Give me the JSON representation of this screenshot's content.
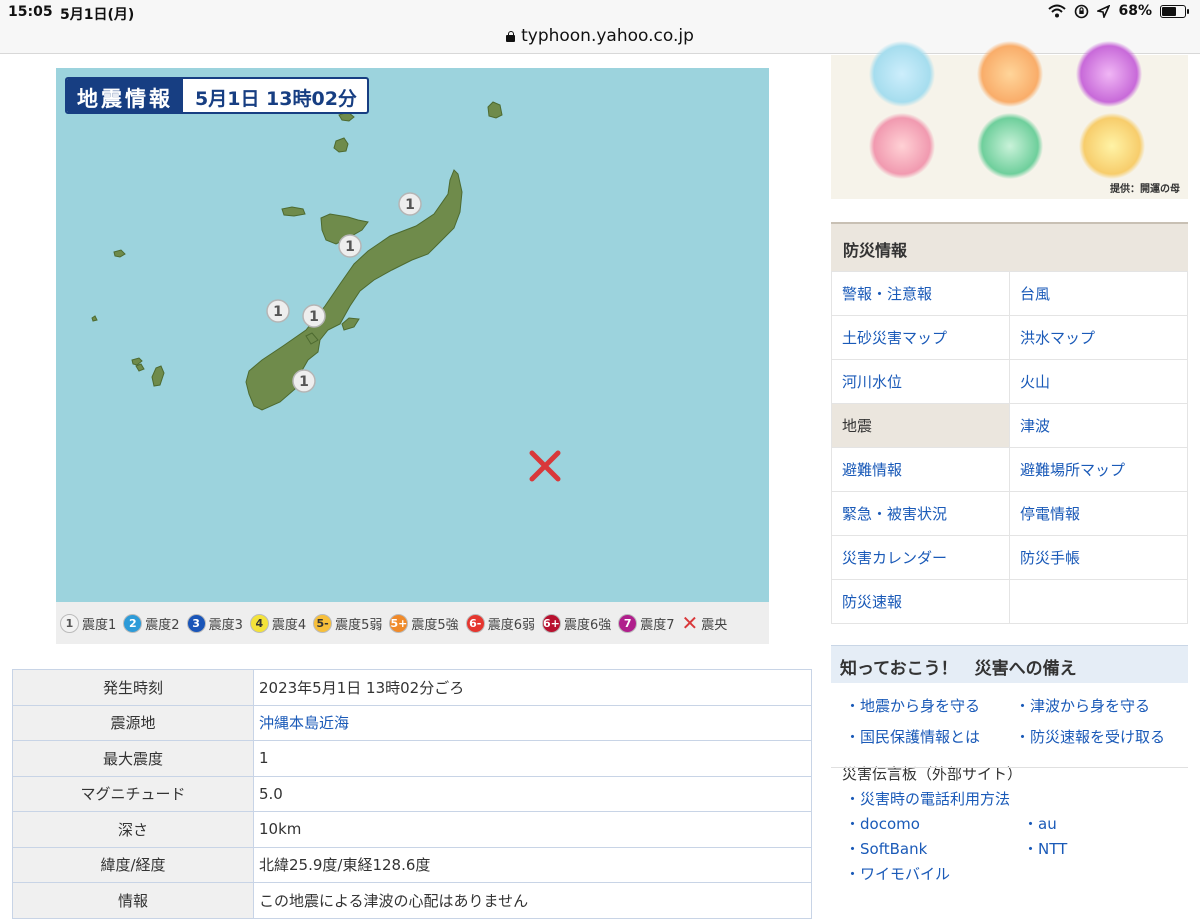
{
  "status_bar": {
    "time": "15:05",
    "date": "5月1日(月)",
    "battery": "68%",
    "battery_level": 0.68
  },
  "browser": {
    "url": "typhoon.yahoo.co.jp"
  },
  "map": {
    "title": "地震情報",
    "datetime": "5月1日 13時02分",
    "intensity_markers": [
      "1",
      "1",
      "1",
      "1",
      "1"
    ],
    "epicenter_icon": "epicenter-x-icon",
    "colors": {
      "sea": "#9cd3dd",
      "land": "#6f8b4b",
      "label": "#173e82",
      "epicenter": "#d9383a"
    }
  },
  "legend": [
    {
      "sym": "1",
      "label": "震度1",
      "bg": "#f2f2f2",
      "fg": "#555"
    },
    {
      "sym": "2",
      "label": "震度2",
      "bg": "#2d9bd8",
      "fg": "#fff"
    },
    {
      "sym": "3",
      "label": "震度3",
      "bg": "#1a55b8",
      "fg": "#fff"
    },
    {
      "sym": "4",
      "label": "震度4",
      "bg": "#f3e23a",
      "fg": "#333"
    },
    {
      "sym": "5-",
      "label": "震度5弱",
      "bg": "#f7bf3a",
      "fg": "#333"
    },
    {
      "sym": "5+",
      "label": "震度5強",
      "bg": "#f08a2a",
      "fg": "#fff"
    },
    {
      "sym": "6-",
      "label": "震度6弱",
      "bg": "#e5362f",
      "fg": "#fff"
    },
    {
      "sym": "6+",
      "label": "震度6強",
      "bg": "#b8112f",
      "fg": "#fff"
    },
    {
      "sym": "7",
      "label": "震度7",
      "bg": "#b01f8c",
      "fg": "#fff"
    }
  ],
  "legend_epicenter": "震央",
  "info_table": [
    {
      "key": "発生時刻",
      "value": "2023年5月1日 13時02分ごろ",
      "link": false
    },
    {
      "key": "震源地",
      "value": "沖縄本島近海",
      "link": true
    },
    {
      "key": "最大震度",
      "value": "1",
      "link": false
    },
    {
      "key": "マグニチュード",
      "value": "5.0",
      "link": false
    },
    {
      "key": "深さ",
      "value": "10km",
      "link": false
    },
    {
      "key": "緯度/経度",
      "value": "北緯25.9度/東経128.6度",
      "link": false
    },
    {
      "key": "情報",
      "value": "この地震による津波の心配はありません",
      "link": false
    }
  ],
  "ad": {
    "credit": "提供：開運の母"
  },
  "bosai": {
    "title": "防災情報",
    "items": [
      "警報・注意報",
      "台風",
      "土砂災害マップ",
      "洪水マップ",
      "河川水位",
      "火山",
      "地震",
      "津波",
      "避難情報",
      "避難場所マップ",
      "緊急・被害状況",
      "停電情報",
      "災害カレンダー",
      "防災手帳",
      "防災速報",
      ""
    ],
    "active": "地震"
  },
  "prep": {
    "title": "知っておこう！　災害への備え",
    "links": [
      "・地震から身を守る",
      "・津波から身を守る",
      "・国民保護情報とは",
      "・防災速報を受け取る"
    ],
    "dengon_title": "災害伝言板（外部サイト）",
    "dengon_links": [
      "・災害時の電話利用方法",
      "",
      "・docomo",
      "・au",
      "・SoftBank",
      "・NTT",
      "・ワイモバイル",
      ""
    ]
  }
}
